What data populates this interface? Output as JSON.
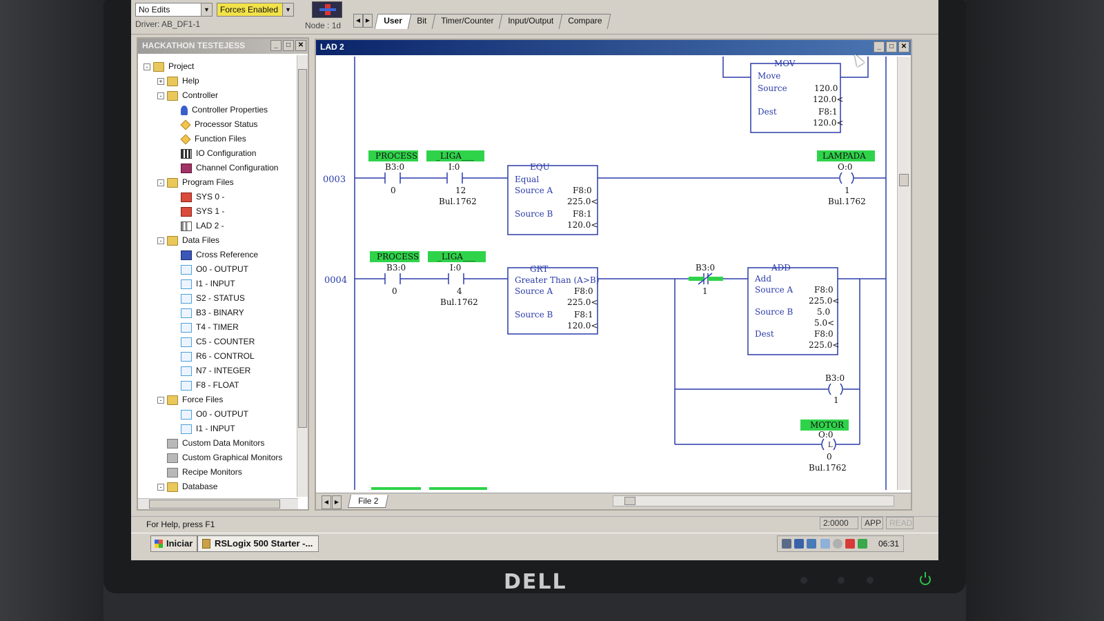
{
  "toolbar": {
    "edits_combo": "No Edits",
    "forces_combo": "Forces Enabled",
    "driver_label": "Driver: AB_DF1-1",
    "node_label": "Node : 1d",
    "instruction_tabs": [
      "User",
      "Bit",
      "Timer/Counter",
      "Input/Output",
      "Compare"
    ]
  },
  "project_window": {
    "title": "HACKATHON TESTEJESS",
    "tree": [
      {
        "label": "Project",
        "level": 0,
        "expander": "-",
        "icon": "folder-icon"
      },
      {
        "label": "Help",
        "level": 1,
        "expander": "+",
        "icon": "folder-icon"
      },
      {
        "label": "Controller",
        "level": 1,
        "expander": "-",
        "icon": "folder-icon"
      },
      {
        "label": "Controller Properties",
        "level": 2,
        "icon": "info-icon"
      },
      {
        "label": "Processor Status",
        "level": 2,
        "icon": "diamond-icon"
      },
      {
        "label": "Function Files",
        "level": 2,
        "icon": "diamond-icon"
      },
      {
        "label": "IO Configuration",
        "level": 2,
        "icon": "io-icon"
      },
      {
        "label": "Channel Configuration",
        "level": 2,
        "icon": "channel-icon"
      },
      {
        "label": "Program Files",
        "level": 1,
        "expander": "-",
        "icon": "folder-icon"
      },
      {
        "label": "SYS 0 -",
        "level": 2,
        "icon": "red-file-icon"
      },
      {
        "label": "SYS 1 -",
        "level": 2,
        "icon": "red-file-icon"
      },
      {
        "label": "LAD 2 -",
        "level": 2,
        "icon": "ladder-icon"
      },
      {
        "label": "Data Files",
        "level": 1,
        "expander": "-",
        "icon": "folder-icon"
      },
      {
        "label": "Cross Reference",
        "level": 2,
        "icon": "xref-icon"
      },
      {
        "label": "O0 - OUTPUT",
        "level": 2,
        "icon": "file-icon"
      },
      {
        "label": "I1 - INPUT",
        "level": 2,
        "icon": "file-icon"
      },
      {
        "label": "S2 - STATUS",
        "level": 2,
        "icon": "file-icon"
      },
      {
        "label": "B3 - BINARY",
        "level": 2,
        "icon": "file-icon"
      },
      {
        "label": "T4 - TIMER",
        "level": 2,
        "icon": "file-icon"
      },
      {
        "label": "C5 - COUNTER",
        "level": 2,
        "icon": "file-icon"
      },
      {
        "label": "R6 - CONTROL",
        "level": 2,
        "icon": "file-icon"
      },
      {
        "label": "N7 - INTEGER",
        "level": 2,
        "icon": "file-icon"
      },
      {
        "label": "F8 - FLOAT",
        "level": 2,
        "icon": "file-icon"
      },
      {
        "label": "Force Files",
        "level": 1,
        "expander": "-",
        "icon": "folder-icon"
      },
      {
        "label": "O0 - OUTPUT",
        "level": 2,
        "icon": "file-icon"
      },
      {
        "label": "I1 - INPUT",
        "level": 2,
        "icon": "file-icon"
      },
      {
        "label": "Custom Data Monitors",
        "level": 1,
        "icon": "gray-folder-icon"
      },
      {
        "label": "Custom Graphical Monitors",
        "level": 1,
        "icon": "gray-folder-icon"
      },
      {
        "label": "Recipe Monitors",
        "level": 1,
        "icon": "gray-folder-icon"
      },
      {
        "label": "Database",
        "level": 1,
        "expander": "-",
        "icon": "folder-icon"
      }
    ]
  },
  "ladder_window": {
    "title": "LAD 2",
    "file_tab": "File 2",
    "mov_block": {
      "name": "MOV",
      "desc": "Move",
      "source_label": "Source",
      "source_value": "120.0",
      "source_live": "120.0<",
      "dest_label": "Dest",
      "dest_value": "F8:1",
      "dest_live": "120.0<"
    },
    "rung_0003": {
      "number": "0003",
      "contact1": {
        "tag": "PROCESS",
        "address": "B3:0",
        "bit": "0"
      },
      "contact2": {
        "tag": "_LIGA___",
        "address": "I:0",
        "bit": "12",
        "module": "Bul.1762"
      },
      "equ": {
        "name": "EQU",
        "desc": "Equal",
        "a_label": "Source A",
        "a_addr": "F8:0",
        "a_val": "225.0<",
        "b_label": "Source B",
        "b_addr": "F8:1",
        "b_val": "120.0<"
      },
      "coil": {
        "tag": "LAMPADA",
        "address": "O:0",
        "bit": "1",
        "module": "Bul.1762"
      }
    },
    "rung_0004": {
      "number": "0004",
      "contact1": {
        "tag": "PROCESS",
        "address": "B3:0",
        "bit": "0"
      },
      "contact2": {
        "tag": "_LIGA___",
        "address": "I:0",
        "bit": "4",
        "module": "Bul.1762"
      },
      "grt": {
        "name": "GRT",
        "desc": "Greater Than (A>B)",
        "a_label": "Source A",
        "a_addr": "F8:0",
        "a_val": "225.0<",
        "b_label": "Source B",
        "b_addr": "F8:1",
        "b_val": "120.0<"
      },
      "contact3": {
        "address": "B3:0",
        "bit": "1"
      },
      "add": {
        "name": "ADD",
        "desc": "Add",
        "a_label": "Source A",
        "a_addr": "F8:0",
        "a_val": "225.0<",
        "b_label": "Source B",
        "b_addr": "5.0",
        "b_val": "5.0<",
        "dest_label": "Dest",
        "dest_addr": "F8:0",
        "dest_val": "225.0<"
      },
      "coil_b3": {
        "address": "B3:0",
        "bit": "1"
      },
      "coil_motor": {
        "tag": "MOTOR",
        "address": "O:0",
        "bit": "0",
        "module": "Bul.1762",
        "type": "L"
      }
    }
  },
  "statusbar": {
    "help": "For Help, press F1",
    "position": "2:0000",
    "mode": "APP",
    "state": "READ"
  },
  "taskbar": {
    "start": "Iniciar",
    "task": "RSLogix 500 Starter -...",
    "clock": "06:31"
  },
  "monitor": {
    "brand": "DELL"
  }
}
